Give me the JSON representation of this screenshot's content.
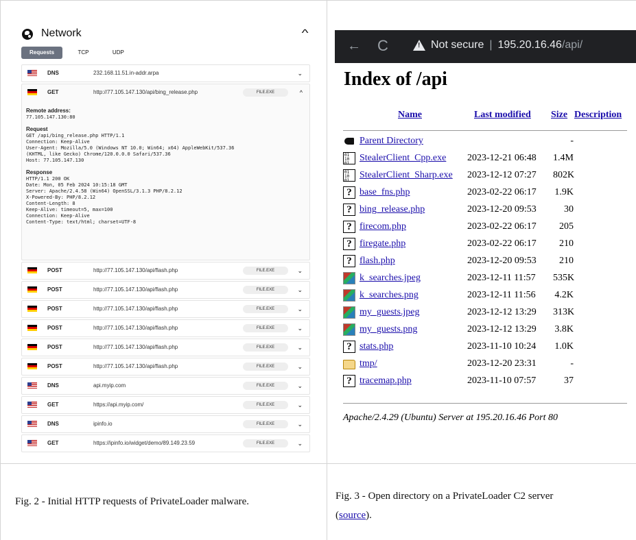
{
  "network": {
    "title": "Network",
    "tabs": [
      "Requests",
      "TCP",
      "UDP"
    ],
    "active_tab": "Requests",
    "rows": [
      {
        "flag": "us",
        "method": "DNS",
        "url": "232.168.11.51.in-addr.arpa",
        "badge": "",
        "chevron": "⌄"
      },
      {
        "flag": "de",
        "method": "GET",
        "url": "http://77.105.147.130/api/bing_release.php",
        "badge": "FILE.EXE",
        "chevron": "^",
        "expanded": true
      },
      {
        "flag": "de",
        "method": "POST",
        "url": "http://77.105.147.130/api/flash.php",
        "badge": "FILE.EXE",
        "chevron": "⌄"
      },
      {
        "flag": "de",
        "method": "POST",
        "url": "http://77.105.147.130/api/flash.php",
        "badge": "FILE.EXE",
        "chevron": "⌄"
      },
      {
        "flag": "de",
        "method": "POST",
        "url": "http://77.105.147.130/api/flash.php",
        "badge": "FILE.EXE",
        "chevron": "⌄"
      },
      {
        "flag": "de",
        "method": "POST",
        "url": "http://77.105.147.130/api/flash.php",
        "badge": "FILE.EXE",
        "chevron": "⌄"
      },
      {
        "flag": "de",
        "method": "POST",
        "url": "http://77.105.147.130/api/flash.php",
        "badge": "FILE.EXE",
        "chevron": "⌄"
      },
      {
        "flag": "de",
        "method": "POST",
        "url": "http://77.105.147.130/api/flash.php",
        "badge": "FILE.EXE",
        "chevron": "⌄"
      },
      {
        "flag": "us",
        "method": "DNS",
        "url": "api.myip.com",
        "badge": "FILE.EXE",
        "chevron": "⌄"
      },
      {
        "flag": "us",
        "method": "GET",
        "url": "https://api.myip.com/",
        "badge": "FILE.EXE",
        "chevron": "⌄"
      },
      {
        "flag": "us",
        "method": "DNS",
        "url": "ipinfo.io",
        "badge": "FILE.EXE",
        "chevron": "⌄"
      },
      {
        "flag": "us",
        "method": "GET",
        "url": "https://ipinfo.io/widget/demo/89.149.23.59",
        "badge": "FILE.EXE",
        "chevron": "⌄"
      }
    ],
    "details": {
      "remote_label": "Remote address:",
      "remote_value": "77.105.147.130:80",
      "request_label": "Request",
      "request_lines": [
        "GET /api/bing_release.php HTTP/1.1",
        "Connection: Keep-Alive",
        "User-Agent: Mozilla/5.0 (Windows NT 10.0; Win64; x64) AppleWebKit/537.36",
        "(KHTML, like Gecko) Chrome/120.0.0.0 Safari/537.36",
        "Host: 77.105.147.130"
      ],
      "response_label": "Response",
      "response_lines": [
        "HTTP/1.1 200 OK",
        "Date: Mon, 05 Feb 2024 10:15:18 GMT",
        "Server: Apache/2.4.58 (Win64) OpenSSL/3.1.3 PHP/8.2.12",
        "X-Powered-By: PHP/8.2.12",
        "Content-Length: 8",
        "Keep-Alive: timeout=5, max=100",
        "Connection: Keep-Alive",
        "Content-Type: text/html; charset=UTF-8"
      ]
    }
  },
  "browser": {
    "back_icon": "←",
    "reload_icon": "C",
    "security_label": "Not secure",
    "host": "195.20.16.46",
    "path": "/api/",
    "page_title": "Index of /api",
    "columns": {
      "name": "Name",
      "modified": "Last modified",
      "size": "Size",
      "description": "Description"
    },
    "entries": [
      {
        "icon": "back",
        "name": "Parent Directory",
        "date": "",
        "size": "-"
      },
      {
        "icon": "bin",
        "name": "StealerClient_Cpp.exe",
        "date": "2023-12-21 06:48",
        "size": "1.4M"
      },
      {
        "icon": "bin",
        "name": "StealerClient_Sharp.exe",
        "date": "2023-12-12 07:27",
        "size": "802K"
      },
      {
        "icon": "unk",
        "name": "base_fns.php",
        "date": "2023-02-22 06:17",
        "size": "1.9K"
      },
      {
        "icon": "unk",
        "name": "bing_release.php",
        "date": "2023-12-20 09:53",
        "size": "30"
      },
      {
        "icon": "unk",
        "name": "firecom.php",
        "date": "2023-02-22 06:17",
        "size": "205"
      },
      {
        "icon": "unk",
        "name": "firegate.php",
        "date": "2023-02-22 06:17",
        "size": "210"
      },
      {
        "icon": "unk",
        "name": "flash.php",
        "date": "2023-12-20 09:53",
        "size": "210"
      },
      {
        "icon": "img",
        "name": "k_searches.jpeg",
        "date": "2023-12-11 11:57",
        "size": "535K"
      },
      {
        "icon": "img",
        "name": "k_searches.png",
        "date": "2023-12-11 11:56",
        "size": "4.2K"
      },
      {
        "icon": "img",
        "name": "my_guests.jpeg",
        "date": "2023-12-12 13:29",
        "size": "313K"
      },
      {
        "icon": "img",
        "name": "my_guests.png",
        "date": "2023-12-12 13:29",
        "size": "3.8K"
      },
      {
        "icon": "unk",
        "name": "stats.php",
        "date": "2023-11-10 10:24",
        "size": "1.0K"
      },
      {
        "icon": "dir",
        "name": "tmp/",
        "date": "2023-12-20 23:31",
        "size": "-"
      },
      {
        "icon": "unk",
        "name": "tracemap.php",
        "date": "2023-11-10 07:57",
        "size": "37"
      }
    ],
    "footer": "Apache/2.4.29 (Ubuntu) Server at 195.20.16.46 Port 80"
  },
  "captions": {
    "fig2": "Fig. 2 - Initial HTTP requests of PrivateLoader malware.",
    "fig3_prefix": "Fig. 3 - Open directory on a PrivateLoader C2 server",
    "fig3_open": "(",
    "fig3_link": "source",
    "fig3_close": ")."
  }
}
